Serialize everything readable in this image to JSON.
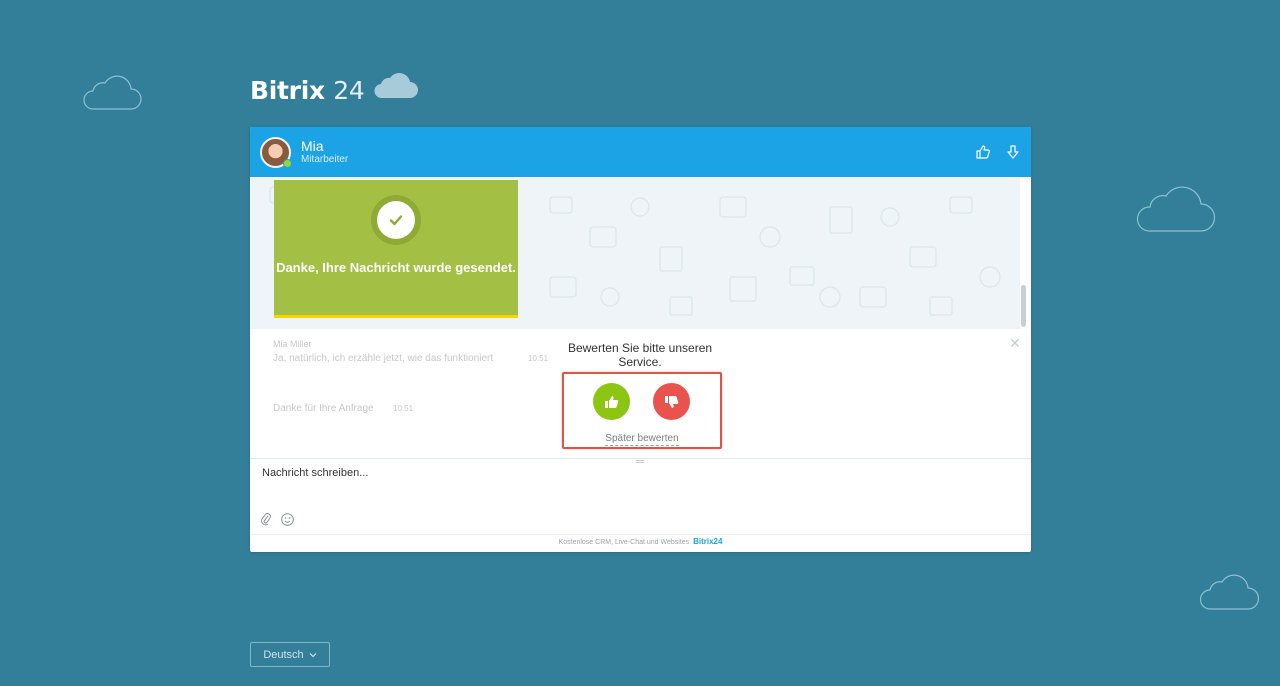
{
  "brand": {
    "name": "Bitrix",
    "number": "24"
  },
  "header": {
    "operator_name": "Mia",
    "operator_role": "Mitarbeiter",
    "like_icon": "thumb-up-outline-icon",
    "download_icon": "download-arrow-icon"
  },
  "success": {
    "message": "Danke, Ihre Nachricht wurde gesendet."
  },
  "faded_messages": [
    {
      "text": "Mia Miller"
    },
    {
      "text": "Ja, natürlich, ich erzähle jetzt, wie das funktioniert"
    },
    {
      "text": "10:51"
    },
    {
      "text": "Danke für Ihre Anfrage"
    },
    {
      "text": "10:51"
    }
  ],
  "rating": {
    "title_line1": "Bewerten Sie bitte unseren",
    "title_line2": "Service.",
    "like_icon": "thumb-up-icon",
    "dislike_icon": "thumb-down-icon",
    "later_label": "Später bewerten",
    "like_color": "#8cc613",
    "dislike_color": "#e9524d"
  },
  "composer": {
    "placeholder": "Nachricht schreiben...",
    "attach_icon": "paperclip-icon",
    "emoji_icon": "smile-icon"
  },
  "footer": {
    "text": "Kostenlose CRM, Live-Chat und Websites",
    "brand": "Bitrix24"
  },
  "language": {
    "label": "Deutsch"
  },
  "colors": {
    "background": "#337e98",
    "header": "#1ba3e6",
    "success": "#a3bf44",
    "highlight_border": "#e05448"
  }
}
